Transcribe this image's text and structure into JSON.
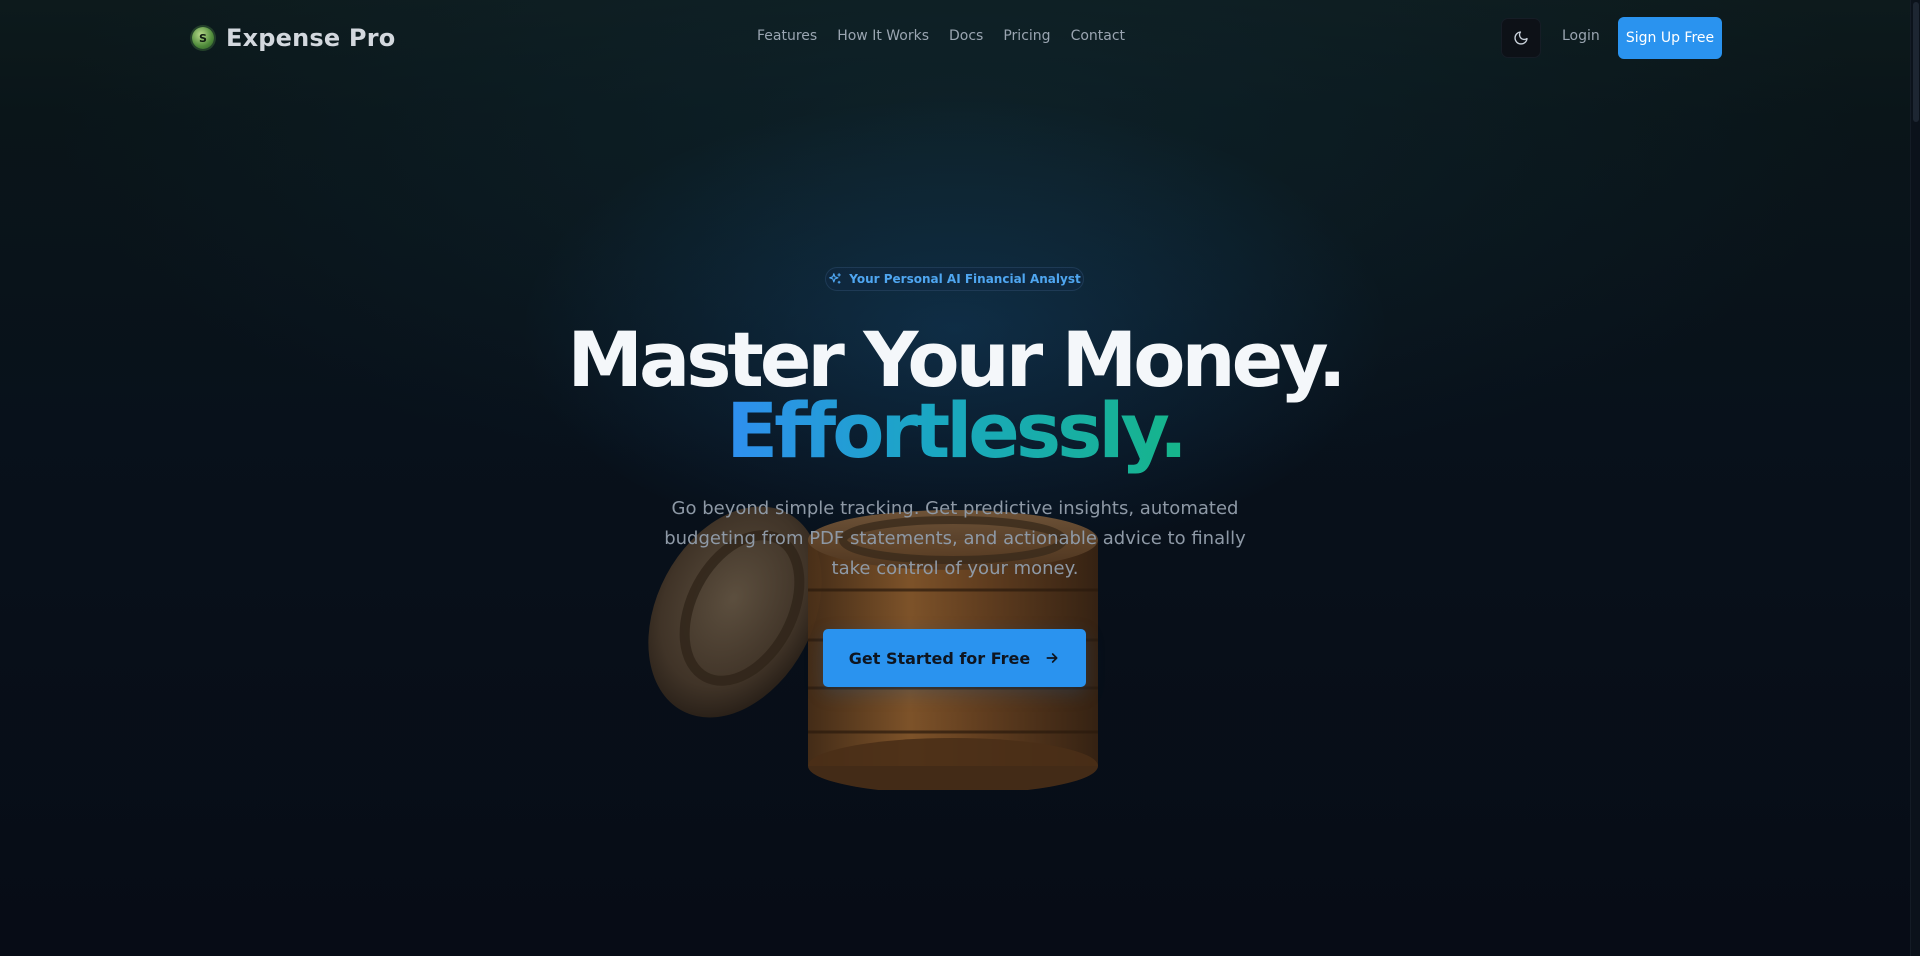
{
  "header": {
    "brand": {
      "logo_letter": "S",
      "name": "Expense Pro"
    },
    "nav": [
      {
        "label": "Features"
      },
      {
        "label": "How It Works"
      },
      {
        "label": "Docs"
      },
      {
        "label": "Pricing"
      },
      {
        "label": "Contact"
      }
    ],
    "theme_toggle_icon": "moon-icon",
    "login_label": "Login",
    "signup_label": "Sign Up Free"
  },
  "hero": {
    "badge": {
      "icon": "sparkles-icon",
      "text": "Your Personal AI Financial Analyst"
    },
    "title_line1": "Master Your Money.",
    "title_line2": "Effortlessly.",
    "subtitle": "Go beyond simple tracking. Get predictive insights, automated budgeting from PDF statements, and actionable advice to finally take control of your money.",
    "cta": {
      "label": "Get Started for Free",
      "icon": "arrow-right-icon"
    }
  },
  "colors": {
    "accent": "#2a93ef",
    "gradient_start": "#2f8ff0",
    "gradient_end": "#16b58a",
    "background": "#070d17"
  }
}
